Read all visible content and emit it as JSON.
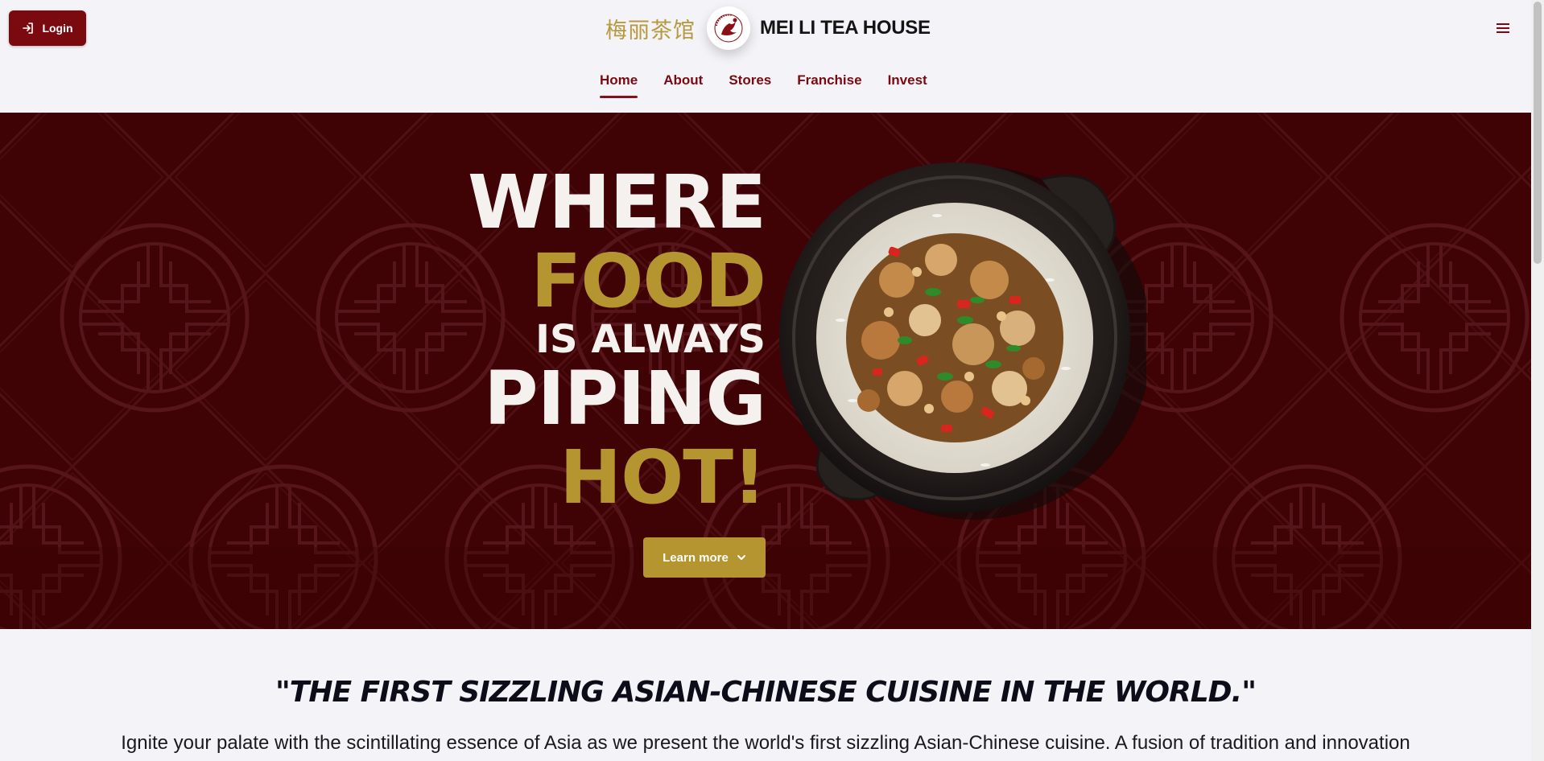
{
  "header": {
    "login_label": "Login",
    "chinese_name": "梅丽茶馆",
    "brand_name": "MEI LI TEA HOUSE",
    "seal_text": "MEI LI TEA HOUSE"
  },
  "nav": {
    "items": [
      {
        "label": "Home",
        "active": true
      },
      {
        "label": "About",
        "active": false
      },
      {
        "label": "Stores",
        "active": false
      },
      {
        "label": "Franchise",
        "active": false
      },
      {
        "label": "Invest",
        "active": false
      }
    ]
  },
  "hero": {
    "line1": "WHERE",
    "line2": "FOOD",
    "line3": "IS ALWAYS",
    "line4": "PIPING",
    "line5": "HOT!",
    "cta_label": "Learn more",
    "colors": {
      "background": "#3f0305",
      "gold": "#b5952f",
      "cream": "#f5f1ee"
    }
  },
  "content": {
    "tagline": "\"THE FIRST SIZZLING ASIAN-CHINESE CUISINE IN THE WORLD.\"",
    "intro": "Ignite your palate with the scintillating essence of Asia as we present the world's first sizzling Asian-Chinese cuisine. A fusion of tradition and innovation"
  },
  "colors": {
    "brand": "#7a0a0f",
    "page_bg": "#f3f3f8"
  }
}
